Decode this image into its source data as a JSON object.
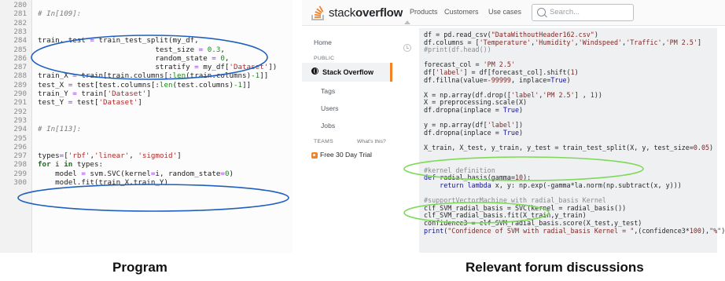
{
  "left_panel": {
    "lines": [
      {
        "num": "280",
        "segs": [
          {
            "t": "",
            "c": "pl"
          }
        ]
      },
      {
        "num": "281",
        "segs": [
          {
            "t": "# In[109]:",
            "c": "cm"
          }
        ]
      },
      {
        "num": "282",
        "segs": [
          {
            "t": "",
            "c": "pl"
          }
        ]
      },
      {
        "num": "283",
        "segs": [
          {
            "t": "",
            "c": "pl"
          }
        ]
      },
      {
        "num": "284",
        "segs": [
          {
            "t": "train, test ",
            "c": "pl"
          },
          {
            "t": "=",
            "c": "op"
          },
          {
            "t": " train_test_split(my_df,",
            "c": "pl"
          }
        ]
      },
      {
        "num": "285",
        "segs": [
          {
            "t": "                           test_size ",
            "c": "pl"
          },
          {
            "t": "=",
            "c": "op"
          },
          {
            "t": " ",
            "c": "pl"
          },
          {
            "t": "0.3",
            "c": "nm"
          },
          {
            "t": ",",
            "c": "pl"
          }
        ]
      },
      {
        "num": "286",
        "segs": [
          {
            "t": "                           random_state ",
            "c": "pl"
          },
          {
            "t": "=",
            "c": "op"
          },
          {
            "t": " ",
            "c": "pl"
          },
          {
            "t": "0",
            "c": "nm"
          },
          {
            "t": ",",
            "c": "pl"
          }
        ]
      },
      {
        "num": "287",
        "segs": [
          {
            "t": "                           stratify ",
            "c": "pl"
          },
          {
            "t": "=",
            "c": "op"
          },
          {
            "t": " my_df[",
            "c": "pl"
          },
          {
            "t": "'Dataset'",
            "c": "st"
          },
          {
            "t": "])",
            "c": "pl"
          }
        ]
      },
      {
        "num": "288",
        "segs": [
          {
            "t": "train_X ",
            "c": "pl"
          },
          {
            "t": "=",
            "c": "op"
          },
          {
            "t": " train[train.columns[:",
            "c": "pl"
          },
          {
            "t": "len",
            "c": "nm"
          },
          {
            "t": "(train.columns)",
            "c": "pl"
          },
          {
            "t": "-1",
            "c": "nm"
          },
          {
            "t": "]]",
            "c": "pl"
          }
        ]
      },
      {
        "num": "289",
        "segs": [
          {
            "t": "test_X ",
            "c": "pl"
          },
          {
            "t": "=",
            "c": "op"
          },
          {
            "t": " test[test.columns[:",
            "c": "pl"
          },
          {
            "t": "len",
            "c": "nm"
          },
          {
            "t": "(test.columns)",
            "c": "pl"
          },
          {
            "t": "-1",
            "c": "nm"
          },
          {
            "t": "]]",
            "c": "pl"
          }
        ]
      },
      {
        "num": "290",
        "segs": [
          {
            "t": "train_Y ",
            "c": "pl"
          },
          {
            "t": "=",
            "c": "op"
          },
          {
            "t": " train[",
            "c": "pl"
          },
          {
            "t": "'Dataset'",
            "c": "st"
          },
          {
            "t": "]",
            "c": "pl"
          }
        ]
      },
      {
        "num": "291",
        "segs": [
          {
            "t": "test_Y ",
            "c": "pl"
          },
          {
            "t": "=",
            "c": "op"
          },
          {
            "t": " test[",
            "c": "pl"
          },
          {
            "t": "'Dataset'",
            "c": "st"
          },
          {
            "t": "]",
            "c": "pl"
          }
        ]
      },
      {
        "num": "292",
        "segs": [
          {
            "t": "",
            "c": "pl"
          }
        ]
      },
      {
        "num": "293",
        "segs": [
          {
            "t": "",
            "c": "pl"
          }
        ]
      },
      {
        "num": "294",
        "segs": [
          {
            "t": "# In[113]:",
            "c": "cm"
          }
        ]
      },
      {
        "num": "295",
        "segs": [
          {
            "t": "",
            "c": "pl"
          }
        ]
      },
      {
        "num": "296",
        "segs": [
          {
            "t": "",
            "c": "pl"
          }
        ]
      },
      {
        "num": "297",
        "segs": [
          {
            "t": "types",
            "c": "pl"
          },
          {
            "t": "=",
            "c": "op"
          },
          {
            "t": "[",
            "c": "pl"
          },
          {
            "t": "'rbf'",
            "c": "st"
          },
          {
            "t": ",",
            "c": "pl"
          },
          {
            "t": "'linear'",
            "c": "st"
          },
          {
            "t": ", ",
            "c": "pl"
          },
          {
            "t": "'sigmoid'",
            "c": "st"
          },
          {
            "t": "]",
            "c": "pl"
          }
        ]
      },
      {
        "num": "298",
        "segs": [
          {
            "t": "for",
            "c": "kw"
          },
          {
            "t": " i ",
            "c": "pl"
          },
          {
            "t": "in",
            "c": "kw"
          },
          {
            "t": " types:",
            "c": "pl"
          }
        ]
      },
      {
        "num": "299",
        "segs": [
          {
            "t": "    model ",
            "c": "pl"
          },
          {
            "t": "=",
            "c": "op"
          },
          {
            "t": " svm.SVC(kernel",
            "c": "pl"
          },
          {
            "t": "=",
            "c": "op"
          },
          {
            "t": "i, random_state",
            "c": "pl"
          },
          {
            "t": "=",
            "c": "op"
          },
          {
            "t": "0",
            "c": "nm"
          },
          {
            "t": ")",
            "c": "pl"
          }
        ]
      },
      {
        "num": "300",
        "segs": [
          {
            "t": "    model.fit(train_X,train_Y)",
            "c": "pl"
          }
        ]
      }
    ]
  },
  "header": {
    "logo_light": "stack",
    "logo_bold": "overflow",
    "nav": [
      "Products",
      "Customers",
      "Use cases"
    ],
    "search_placeholder": "Search..."
  },
  "sidebar": {
    "home": "Home",
    "public": "PUBLIC",
    "active": "Stack Overflow",
    "tags": "Tags",
    "users": "Users",
    "jobs": "Jobs",
    "teams": "TEAMS",
    "whats_this": "What's this?",
    "trial": "Free 30 Day Trial"
  },
  "post": {
    "lines": [
      {
        "segs": [
          {
            "t": "df = pd.read_csv(",
            "c": "pl"
          },
          {
            "t": "\"DataWithoutHeader162.csv\"",
            "c": "ps"
          },
          {
            "t": ")",
            "c": "pl"
          }
        ]
      },
      {
        "segs": [
          {
            "t": "df.columns = [",
            "c": "pl"
          },
          {
            "t": "'Temperature'",
            "c": "ps"
          },
          {
            "t": ",",
            "c": "pl"
          },
          {
            "t": "'Humidity'",
            "c": "ps"
          },
          {
            "t": ",",
            "c": "pl"
          },
          {
            "t": "'Windspeed'",
            "c": "ps"
          },
          {
            "t": ",",
            "c": "pl"
          },
          {
            "t": "'Traffic'",
            "c": "ps"
          },
          {
            "t": ",",
            "c": "pl"
          },
          {
            "t": "'PM 2.5'",
            "c": "ps"
          },
          {
            "t": "]",
            "c": "pl"
          }
        ]
      },
      {
        "segs": [
          {
            "t": "#print(df.head())",
            "c": "pc"
          }
        ]
      },
      {
        "segs": [
          {
            "t": "",
            "c": "pl"
          }
        ]
      },
      {
        "segs": [
          {
            "t": "forecast_col = ",
            "c": "pl"
          },
          {
            "t": "'PM 2.5'",
            "c": "ps"
          }
        ]
      },
      {
        "segs": [
          {
            "t": "df[",
            "c": "pl"
          },
          {
            "t": "'label'",
            "c": "ps"
          },
          {
            "t": "] = df[forecast_col].shift(",
            "c": "pl"
          },
          {
            "t": "1",
            "c": "pn"
          },
          {
            "t": ")",
            "c": "pl"
          }
        ]
      },
      {
        "segs": [
          {
            "t": "df.fillna(value=",
            "c": "pl"
          },
          {
            "t": "-99999",
            "c": "pn"
          },
          {
            "t": ", inplace=",
            "c": "pl"
          },
          {
            "t": "True",
            "c": "pk"
          },
          {
            "t": ")",
            "c": "pl"
          }
        ]
      },
      {
        "segs": [
          {
            "t": "",
            "c": "pl"
          }
        ]
      },
      {
        "segs": [
          {
            "t": "X = np.array(df.drop([",
            "c": "pl"
          },
          {
            "t": "'label'",
            "c": "ps"
          },
          {
            "t": ",",
            "c": "pl"
          },
          {
            "t": "'PM 2.5'",
            "c": "ps"
          },
          {
            "t": "] , ",
            "c": "pl"
          },
          {
            "t": "1",
            "c": "pn"
          },
          {
            "t": "))",
            "c": "pl"
          }
        ]
      },
      {
        "segs": [
          {
            "t": "X = preprocessing.scale(X)",
            "c": "pl"
          }
        ]
      },
      {
        "segs": [
          {
            "t": "df.dropna(inplace = ",
            "c": "pl"
          },
          {
            "t": "True",
            "c": "pk"
          },
          {
            "t": ")",
            "c": "pl"
          }
        ]
      },
      {
        "segs": [
          {
            "t": "",
            "c": "pl"
          }
        ]
      },
      {
        "segs": [
          {
            "t": "y = np.array(df[",
            "c": "pl"
          },
          {
            "t": "'label'",
            "c": "ps"
          },
          {
            "t": "])",
            "c": "pl"
          }
        ]
      },
      {
        "segs": [
          {
            "t": "df.dropna(inplace = ",
            "c": "pl"
          },
          {
            "t": "True",
            "c": "pk"
          },
          {
            "t": ")",
            "c": "pl"
          }
        ]
      },
      {
        "segs": [
          {
            "t": "",
            "c": "pl"
          }
        ]
      },
      {
        "segs": [
          {
            "t": "X_train, X_test, y_train, y_test = train_test_split(X, y, test_size=",
            "c": "pl"
          },
          {
            "t": "0.05",
            "c": "pn"
          },
          {
            "t": ")",
            "c": "pl"
          }
        ]
      },
      {
        "segs": [
          {
            "t": "",
            "c": "pl"
          }
        ]
      },
      {
        "segs": [
          {
            "t": "",
            "c": "pl"
          }
        ]
      },
      {
        "segs": [
          {
            "t": "#kernel definition",
            "c": "pc"
          }
        ]
      },
      {
        "segs": [
          {
            "t": "def",
            "c": "pk"
          },
          {
            "t": " radial_basis(gamma=",
            "c": "pl"
          },
          {
            "t": "10",
            "c": "pn"
          },
          {
            "t": "):",
            "c": "pl"
          }
        ]
      },
      {
        "segs": [
          {
            "t": "    ",
            "c": "pl"
          },
          {
            "t": "return",
            "c": "pk"
          },
          {
            "t": " ",
            "c": "pl"
          },
          {
            "t": "lambda",
            "c": "pk"
          },
          {
            "t": " x, y: np.exp(-gamma*la.norm(np.subtract(x, y)))",
            "c": "pl"
          }
        ]
      },
      {
        "segs": [
          {
            "t": "",
            "c": "pl"
          }
        ]
      },
      {
        "segs": [
          {
            "t": "#supportVectorMachine with radial_basis Kernel",
            "c": "pc"
          }
        ]
      },
      {
        "segs": [
          {
            "t": "clf_SVM_radial_basis = SVC(kernel = radial_basis())",
            "c": "pl"
          }
        ]
      },
      {
        "segs": [
          {
            "t": "clf_SVM_radial_basis.fit(X_train,y_train)",
            "c": "pl"
          }
        ]
      },
      {
        "segs": [
          {
            "t": "confidence3 = clf_SVM_radial_basis.score(X_test,y_test)",
            "c": "pl"
          }
        ]
      },
      {
        "segs": [
          {
            "t": "print",
            "c": "pk"
          },
          {
            "t": "(",
            "c": "pl"
          },
          {
            "t": "\"Confidence of SVM with radial_basis Kernel = \"",
            "c": "ps"
          },
          {
            "t": ",(confidence3*",
            "c": "pl"
          },
          {
            "t": "100",
            "c": "pn"
          },
          {
            "t": "),",
            "c": "pl"
          },
          {
            "t": "\"%\"",
            "c": "ps"
          },
          {
            "t": ")",
            "c": "pl"
          }
        ]
      }
    ]
  },
  "captions": {
    "left": "Program",
    "right": "Relevant forum discussions"
  },
  "colors": {
    "highlight_blue": "#1f5fbf",
    "highlight_green": "#7ed957",
    "brand_orange": "#f48225"
  }
}
